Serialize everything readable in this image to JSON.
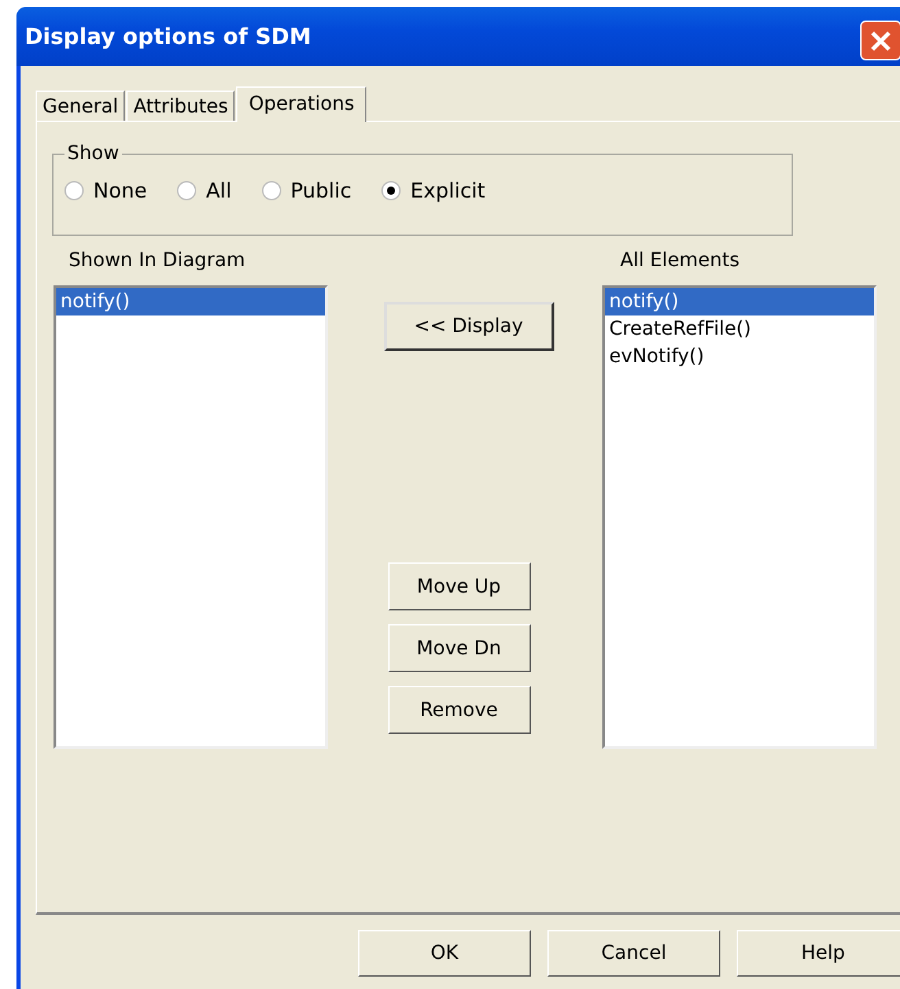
{
  "window": {
    "title": "Display options of SDM"
  },
  "tabs": [
    {
      "label": "General",
      "selected": false
    },
    {
      "label": "Attributes",
      "selected": false
    },
    {
      "label": "Operations",
      "selected": true
    }
  ],
  "show_group": {
    "title": "Show",
    "options": [
      {
        "label": "None",
        "selected": false
      },
      {
        "label": "All",
        "selected": false
      },
      {
        "label": "Public",
        "selected": false
      },
      {
        "label": "Explicit",
        "selected": true
      }
    ]
  },
  "shown_in_diagram": {
    "label": "Shown In Diagram",
    "items": [
      {
        "label": "notify()",
        "selected": true
      }
    ]
  },
  "all_elements": {
    "label": "All Elements",
    "items": [
      {
        "label": "notify()",
        "selected": true
      },
      {
        "label": "CreateRefFile()",
        "selected": false
      },
      {
        "label": "evNotify()",
        "selected": false
      }
    ]
  },
  "display_button": "<< Display",
  "order_buttons": [
    "Move Up",
    "Move Dn",
    "Remove"
  ],
  "buttons": [
    "OK",
    "Cancel",
    "Help"
  ]
}
